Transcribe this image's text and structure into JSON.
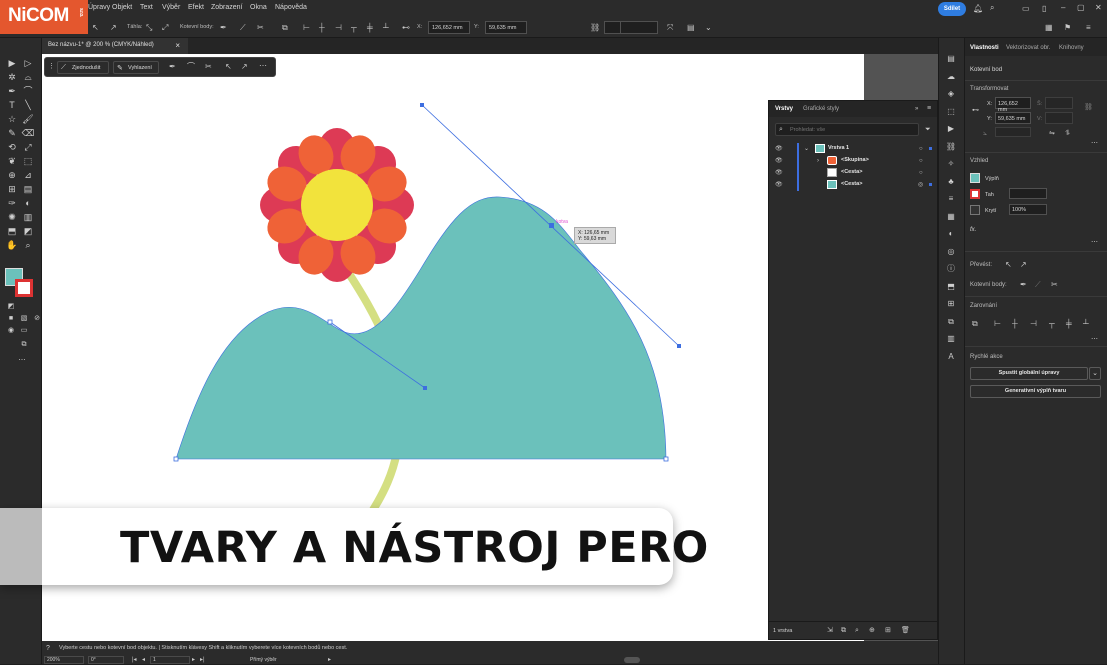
{
  "logo": {
    "text": "NiCOM",
    "sub": "s.r.o."
  },
  "menu": [
    "Úpravy",
    "Objekt",
    "Text",
    "Výběr",
    "Efekt",
    "Zobrazení",
    "Okna",
    "Nápověda"
  ],
  "share_label": "Sdílet",
  "controlbar": {
    "handles_label": "Táhla:",
    "anchors_label": "Kotevní body:",
    "x_label": "X:",
    "x_value": "126,652 mm",
    "y_label": "Y:",
    "y_value": "59,635 mm"
  },
  "document": {
    "tab_title": "Bez názvu-1* @ 200 % (CMYK/Náhled)",
    "close": "×"
  },
  "context_bar": {
    "simplify": "Zjednodušit",
    "smooth": "Vyhlazení"
  },
  "tooltip": {
    "label": "kotva",
    "x": "X: 126,65 mm",
    "y": "Y: 59,63 mm"
  },
  "layers_panel": {
    "tabs": [
      "Vrstvy",
      "Grafické styly"
    ],
    "search_placeholder": "Prohledat: vše",
    "rows": [
      "Vrstva 1",
      "<Skupina>",
      "<Cesta>",
      "<Cesta>"
    ],
    "footer": "1 vrstva"
  },
  "properties_panel": {
    "tabs": [
      "Vlastnosti",
      "Vektorizovat obr.",
      "Knihovny"
    ],
    "anchor_label": "Kotevní bod",
    "transform_title": "Transformovat",
    "x_label": "X:",
    "x_value": "126,652 mm",
    "y_label": "Y:",
    "y_value": "59,635 mm",
    "w_label": "Š:",
    "h_label": "V:",
    "appearance_title": "Vzhled",
    "fill_label": "Výplň",
    "stroke_label": "Tah",
    "opacity_label": "Krytí",
    "opacity_value": "100%",
    "fx_label": "fx.",
    "convert_label": "Převést:",
    "anchors_label": "Kotevní body:",
    "align_title": "Zarovnání",
    "quick_title": "Rychlé akce",
    "btn_global_edit": "Spustit globální úpravy",
    "btn_gen_fill": "Generativní výplň tvaru"
  },
  "status": {
    "message": "Vyberte cestu nebo kotevní bod objektu. | Stisknutím klávesy Shift a kliknutím vyberete více kotevních bodů nebo cest.",
    "zoom": "200%",
    "rotation": "0°",
    "artboard": "1",
    "mode": "Přímý výběr"
  },
  "banner": {
    "title": "TVARY A NÁSTROJ PERO"
  },
  "colors": {
    "accent": "#2f7de1",
    "logo_bg": "#e4572e",
    "hill": "#6bc1bb",
    "petal_red": "#dd3a55",
    "petal_orange": "#ef6237",
    "center": "#f2e33c",
    "stem": "#d4df82",
    "path_blue": "#3d6ee0"
  }
}
